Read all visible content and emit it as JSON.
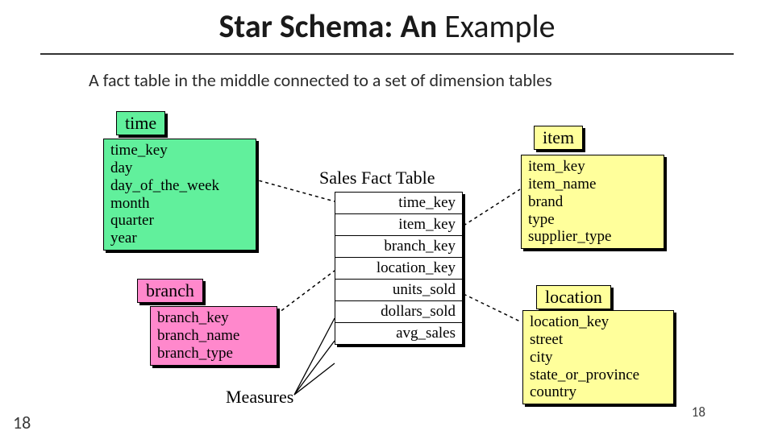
{
  "title_prefix": "Star Schema: An ",
  "title_suffix": "Example",
  "subtitle": "A fact table in the middle connected to a set of dimension tables",
  "fact_title": "Sales Fact Table",
  "fact_rows": {
    "r0": "time_key",
    "r1": "item_key",
    "r2": "branch_key",
    "r3": "location_key",
    "r4": "units_sold",
    "r5": "dollars_sold",
    "r6": "avg_sales"
  },
  "dims": {
    "time": {
      "label": "time",
      "attrs": "time_key\nday\nday_of_the_week\nmonth\nquarter\nyear"
    },
    "item": {
      "label": "item",
      "attrs": "item_key\nitem_name\nbrand\ntype\nsupplier_type"
    },
    "branch": {
      "label": "branch",
      "attrs": "branch_key\nbranch_name\nbranch_type"
    },
    "location": {
      "label": "location",
      "attrs": "location_key\nstreet\ncity\nstate_or_province\ncountry"
    }
  },
  "measures_label": "Measures",
  "page_number": "18"
}
